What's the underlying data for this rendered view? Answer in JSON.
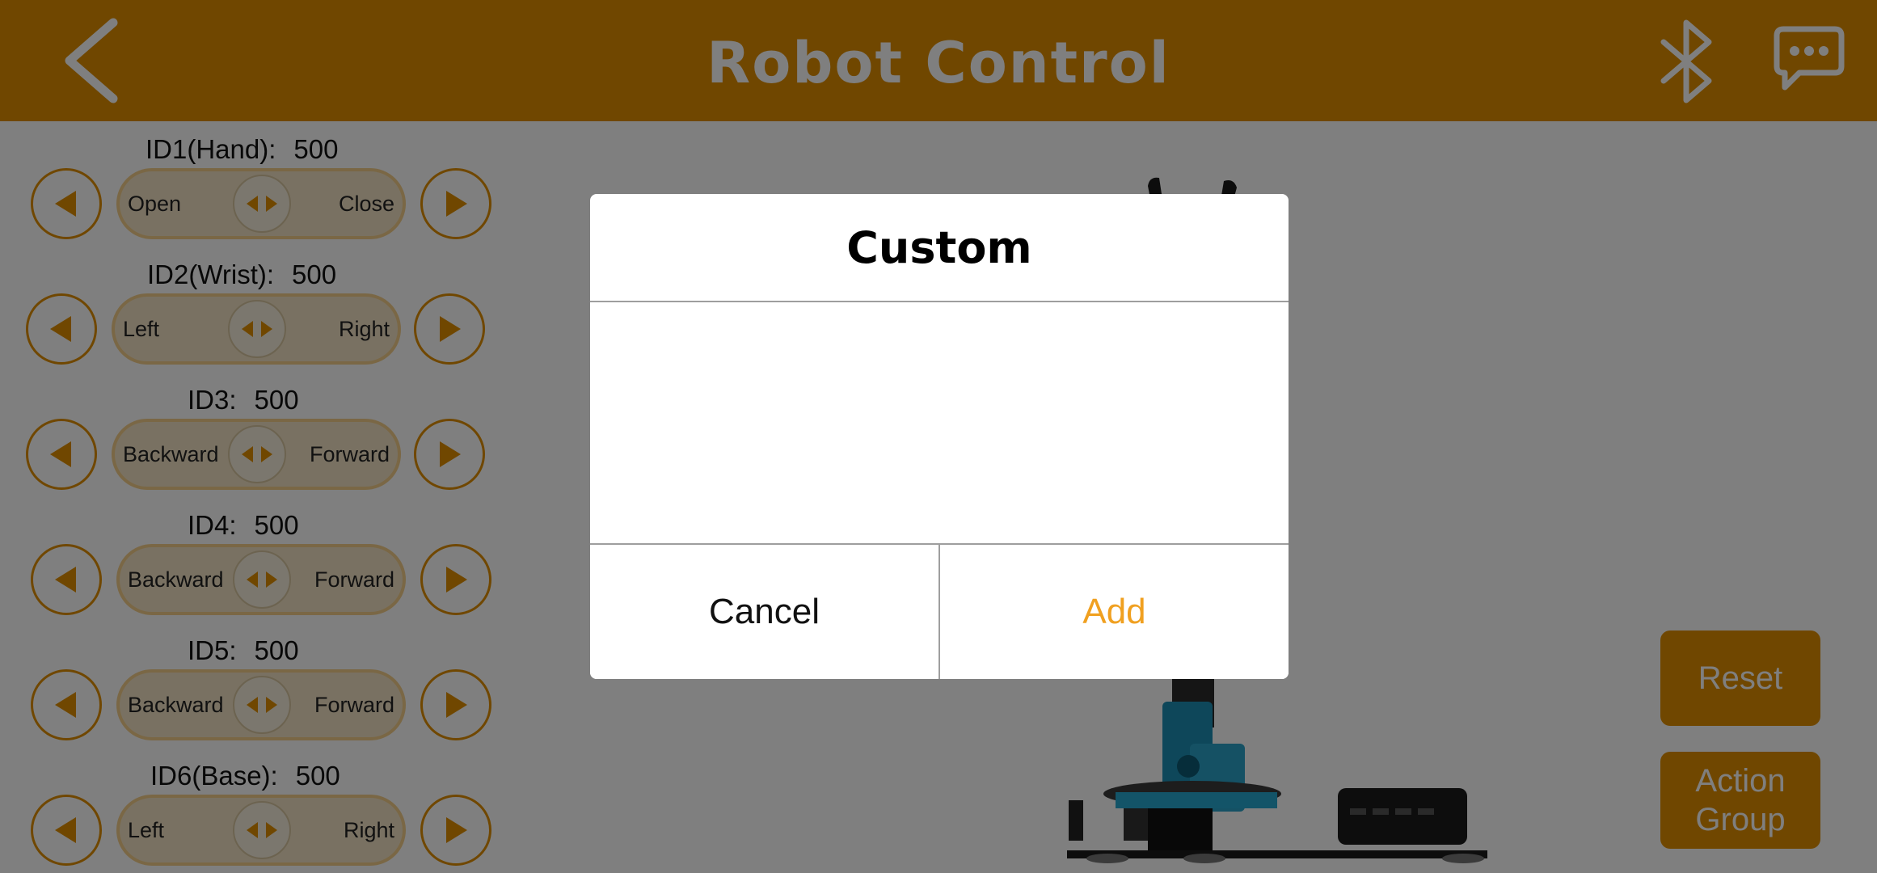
{
  "header": {
    "title": "Robot Control",
    "back_icon": "chevron-left-icon",
    "bluetooth_icon": "bluetooth-icon",
    "message_icon": "chat-bubble-icon"
  },
  "servos": [
    {
      "label": "ID1(Hand):",
      "value": "500",
      "left": "Open",
      "right": "Close"
    },
    {
      "label": "ID2(Wrist):",
      "value": "500",
      "left": "Left",
      "right": "Right"
    },
    {
      "label": "ID3:",
      "value": "500",
      "left": "Backward",
      "right": "Forward"
    },
    {
      "label": "ID4:",
      "value": "500",
      "left": "Backward",
      "right": "Forward"
    },
    {
      "label": "ID5:",
      "value": "500",
      "left": "Backward",
      "right": "Forward"
    },
    {
      "label": "ID6(Base):",
      "value": "500",
      "left": "Left",
      "right": "Right"
    }
  ],
  "side_buttons": {
    "reset": "Reset",
    "action_group": "Action\nGroup"
  },
  "dialog": {
    "title": "Custom",
    "input_value": "",
    "cancel": "Cancel",
    "add": "Add"
  },
  "colors": {
    "accent": "#e08f00",
    "add_text": "#f0a020",
    "overlay": "rgba(0,0,0,0.5)"
  }
}
